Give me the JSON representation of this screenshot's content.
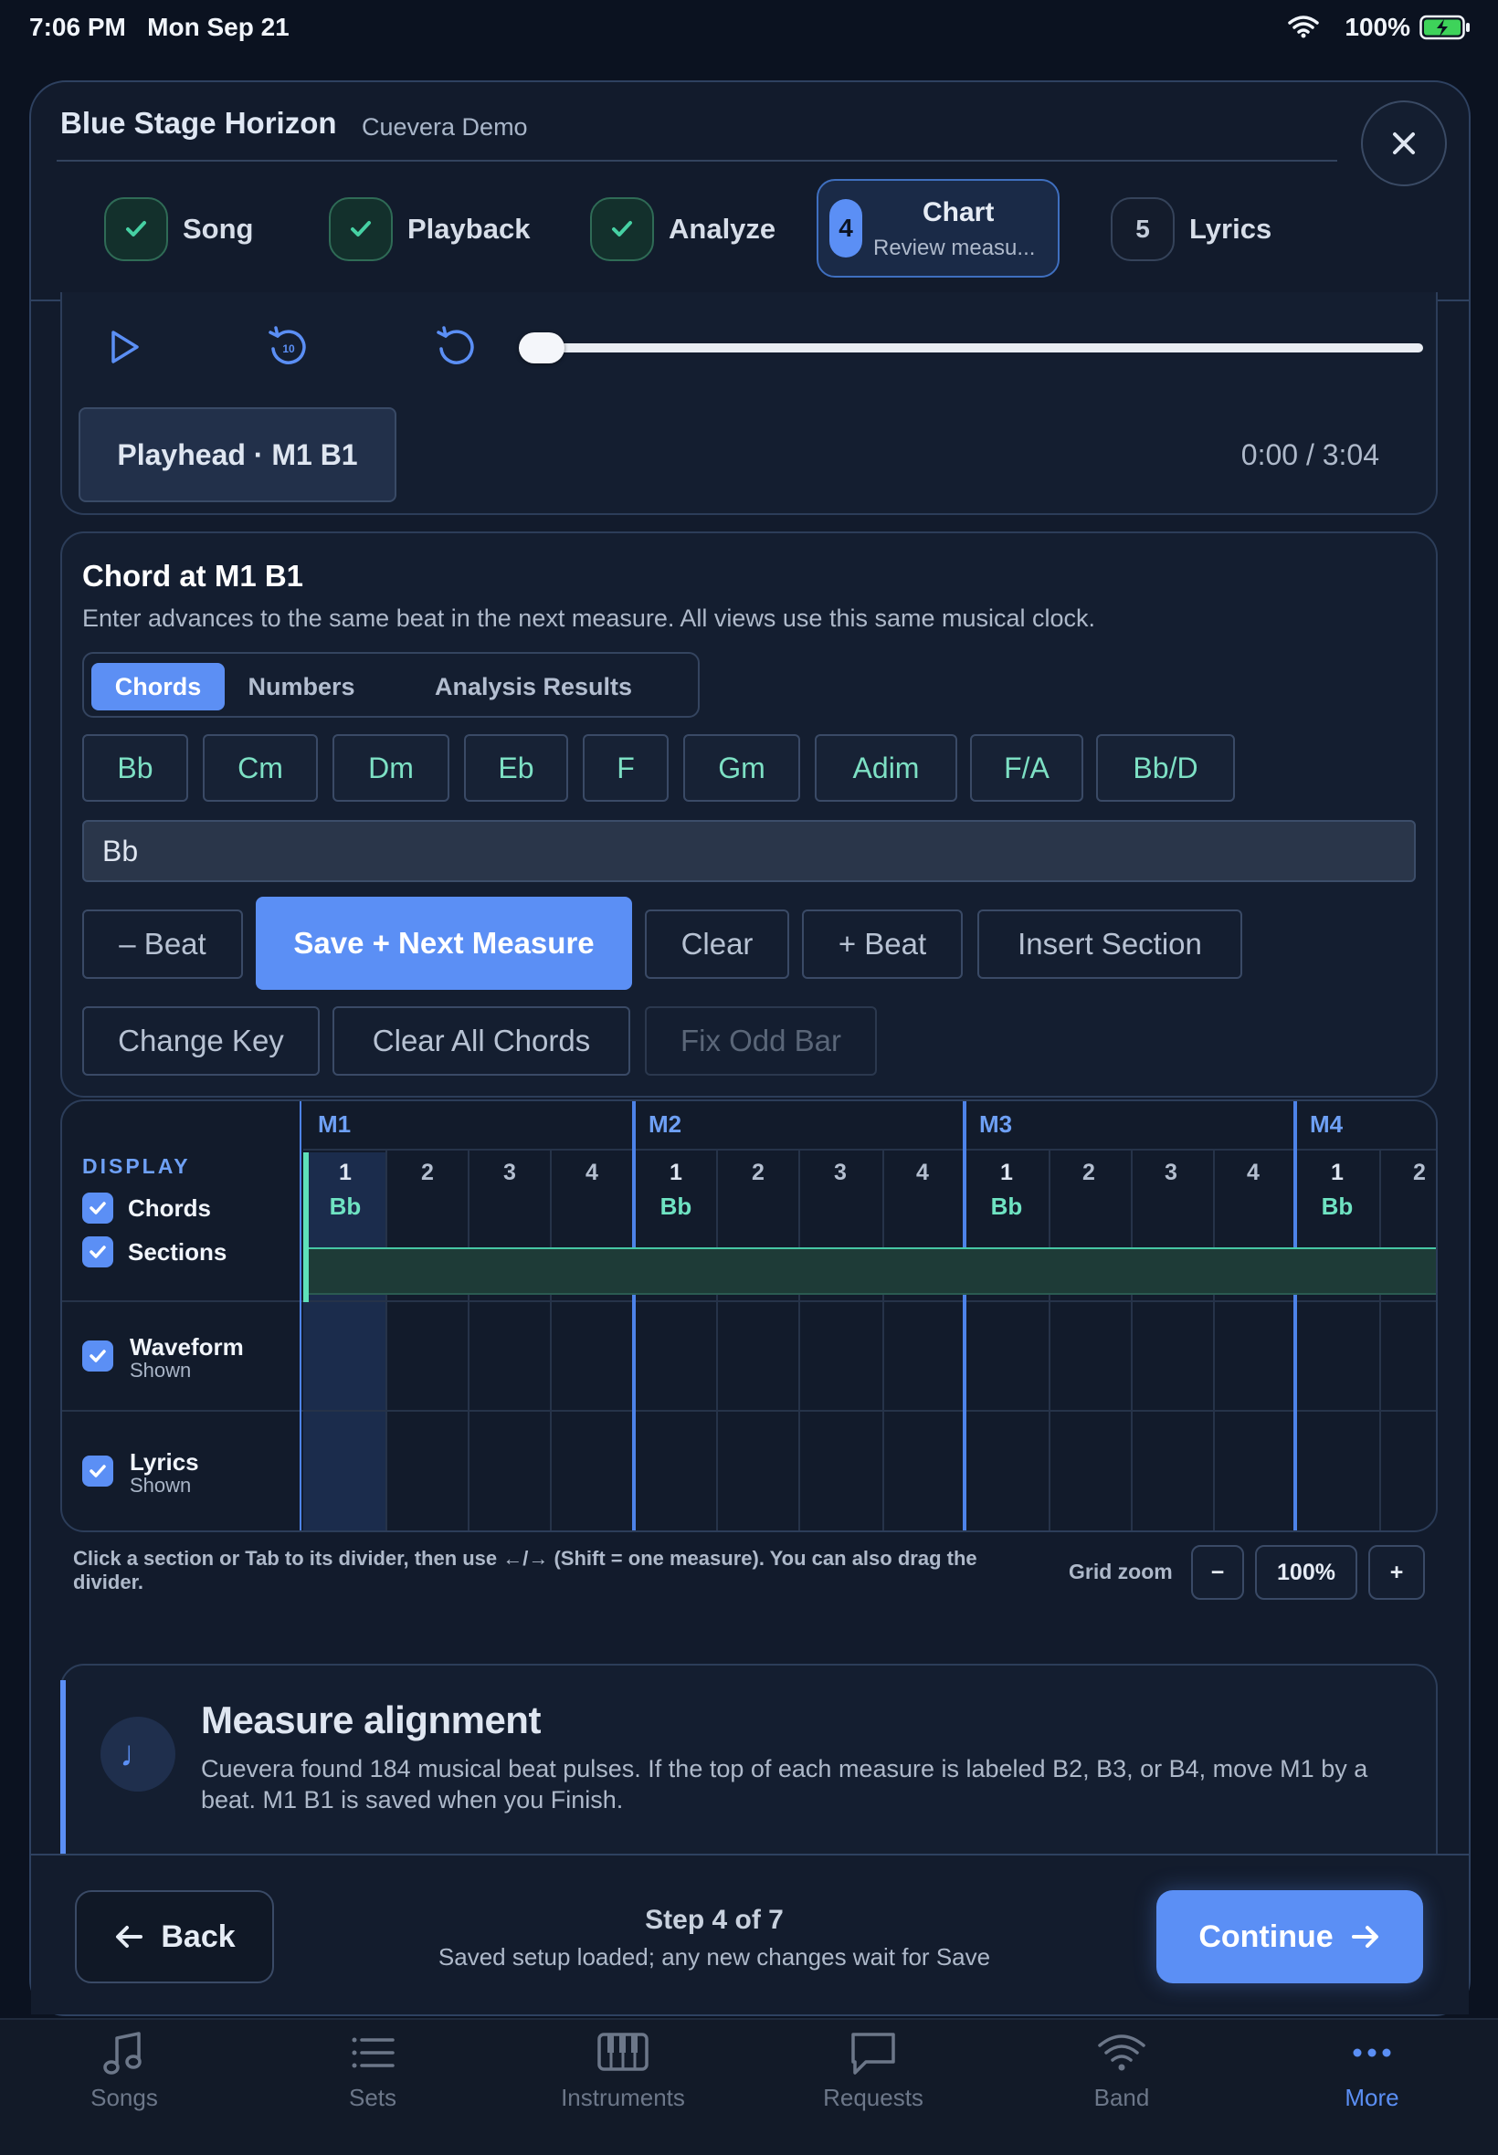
{
  "status_bar": {
    "time": "7:06 PM   Mon Sep 21",
    "battery": "100%"
  },
  "header": {
    "title": "Blue Stage Horizon",
    "subtitle": "Cuevera Demo"
  },
  "steps": [
    {
      "label": "Song",
      "state": "done"
    },
    {
      "label": "Playback",
      "state": "done"
    },
    {
      "label": "Analyze",
      "state": "done"
    },
    {
      "number": "4",
      "label": "Chart",
      "sublabel": "Review measu...",
      "state": "active"
    },
    {
      "number": "5",
      "label": "Lyrics",
      "state": "pending"
    }
  ],
  "transport": {
    "playhead_label": "Playhead · M1 B1",
    "time": "0:00 / 3:04",
    "progress_percent": 0
  },
  "chord_editor": {
    "title": "Chord at M1 B1",
    "help": "Enter advances to the same beat in the next measure. All views use this same musical clock.",
    "tabs": [
      "Chords",
      "Numbers",
      "Analysis Results"
    ],
    "selected_tab": "Chords",
    "chips": [
      "Bb",
      "Cm",
      "Dm",
      "Eb",
      "F",
      "Gm",
      "Adim",
      "F/A",
      "Bb/D"
    ],
    "input_value": "Bb",
    "buttons": {
      "minus_beat": "– Beat",
      "save_next": "Save + Next Measure",
      "clear": "Clear",
      "plus_beat": "+ Beat",
      "insert_section": "Insert Section",
      "change_key": "Change Key",
      "clear_all": "Clear All Chords",
      "fix_odd_bar": "Fix Odd Bar"
    }
  },
  "grid": {
    "display_label": "DISPLAY",
    "toggles": [
      {
        "label": "Chords",
        "checked": true
      },
      {
        "label": "Sections",
        "checked": true
      },
      {
        "label": "Waveform",
        "sub": "Shown",
        "checked": true
      },
      {
        "label": "Lyrics",
        "sub": "Shown",
        "checked": true
      }
    ],
    "measures": [
      "M1",
      "M2",
      "M3",
      "M4"
    ],
    "beats": [
      "1",
      "2",
      "3",
      "4"
    ],
    "chord_on_beat_1": "Bb",
    "help": "Click a section or Tab to its divider, then use ←/→ (Shift = one measure). You can also drag the divider.",
    "zoom_label": "Grid zoom",
    "zoom_minus": "−",
    "zoom_value": "100%",
    "zoom_plus": "+"
  },
  "alignment": {
    "title": "Measure alignment",
    "body": "Cuevera found 184 musical beat pulses. If the top of each measure is labeled B2, B3, or B4, move M1 by a beat. M1 B1 is saved when you Finish."
  },
  "footer": {
    "back": "Back",
    "step": "Step 4 of 7",
    "status": "Saved setup loaded; any new changes wait for Save",
    "continue": "Continue"
  },
  "tabbar": [
    {
      "label": "Songs",
      "icon": "music-note-icon"
    },
    {
      "label": "Sets",
      "icon": "list-icon"
    },
    {
      "label": "Instruments",
      "icon": "piano-icon"
    },
    {
      "label": "Requests",
      "icon": "speech-bubble-icon"
    },
    {
      "label": "Band",
      "icon": "wifi-icon"
    },
    {
      "label": "More",
      "icon": "ellipsis-icon",
      "active": true
    }
  ],
  "colors": {
    "accent": "#5b8ff5",
    "chord_text": "#6fe3c2",
    "background": "#0b1220"
  }
}
